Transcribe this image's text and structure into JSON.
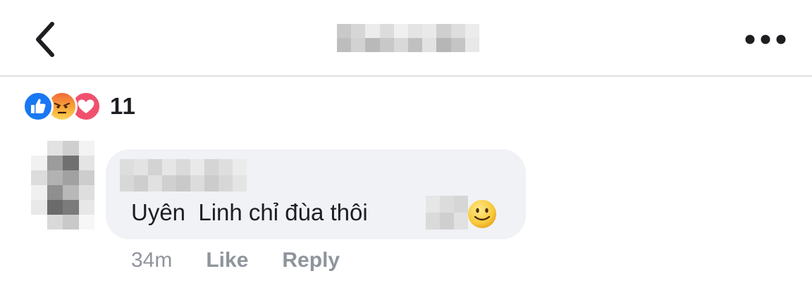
{
  "reactions": {
    "icons": [
      "like-reaction",
      "angry-reaction",
      "love-reaction"
    ],
    "count": "11"
  },
  "comment": {
    "text": "Uyên  Linh chỉ đùa thôi",
    "emoji": "slightly-smiling-face"
  },
  "comment_actions": {
    "timestamp": "34m",
    "like_label": "Like",
    "reply_label": "Reply"
  },
  "colors": {
    "like": "#1877f2",
    "love": "#f0506e",
    "angry_top": "#f16a3b",
    "angry_bottom": "#fcd457",
    "bubble": "#f0f2f5",
    "muted_text": "#90949c"
  },
  "redactions": {
    "header_title": {
      "cols": 10,
      "rows": 2,
      "cells": [
        "#c9c9c9",
        "#d6d6d6",
        "#ececec",
        "#dcdcdc",
        "#f0f0f0",
        "#e4e4e4",
        "#e9e9e9",
        "#cfcfcf",
        "#dedede",
        "#ececec",
        "#bdbdbd",
        "#d2d2d2",
        "#b9b9b9",
        "#c8c8c8",
        "#d9d9d9",
        "#c0c0c0",
        "#e2e2e2",
        "#b6b6b6",
        "#c5c5c5",
        "#e8e8e8"
      ]
    },
    "commenter_name": {
      "cols": 9,
      "rows": 2,
      "cells": [
        "#dddddd",
        "#e3e3e3",
        "#d3d3d3",
        "#e6e6e6",
        "#dadada",
        "#e9e9e9",
        "#d5d5d5",
        "#dedede",
        "#ebebeb",
        "#d8d8d8",
        "#cecece",
        "#e1e1e1",
        "#d0d0d0",
        "#c9c9c9",
        "#dcdcdc",
        "#cccccc",
        "#d7d7d7",
        "#e4e4e4"
      ]
    },
    "avatar": {
      "cols": 4,
      "rows": 6,
      "cells": [
        "#ffffff",
        "#e2e2e2",
        "#cfcfcf",
        "#f3f3f3",
        "#f1f1f1",
        "#9c9c9c",
        "#707070",
        "#e4e4e4",
        "#dcdcdc",
        "#b2b2b2",
        "#a1a1a1",
        "#cdcdcd",
        "#f0f0f0",
        "#8f8f8f",
        "#b8b8b8",
        "#dedede",
        "#e9e9e9",
        "#6b6b6b",
        "#7b7b7b",
        "#e7e7e7",
        "#ffffff",
        "#d9d9d9",
        "#c9c9c9",
        "#f7f7f7"
      ]
    },
    "comment_tag": {
      "cols": 3,
      "rows": 2,
      "cells": [
        "#e6e6e6",
        "#dcdcdc",
        "#d6d6d6",
        "#dadada",
        "#cfcfcf",
        "#e1e1e1"
      ]
    }
  }
}
